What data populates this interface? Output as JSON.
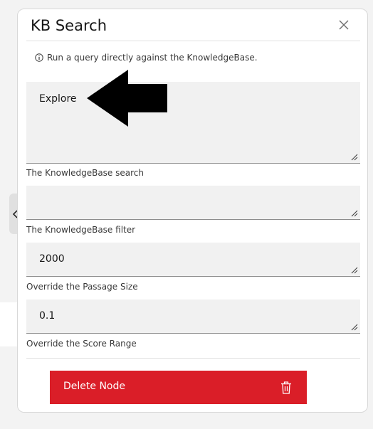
{
  "panel": {
    "title": "KB Search",
    "info_text": "Run a query directly against the KnowledgeBase."
  },
  "fields": [
    {
      "value": "Explore",
      "label": "The KnowledgeBase search"
    },
    {
      "value": "",
      "label": "The KnowledgeBase filter"
    },
    {
      "value": "2000",
      "label": "Override the Passage Size"
    },
    {
      "value": "0.1",
      "label": "Override the Score Range"
    }
  ],
  "delete_button": {
    "label": "Delete Node"
  },
  "icons": {
    "close": "close-icon",
    "info": "info-icon",
    "collapse": "chevron-left-icon",
    "trash": "trash-icon",
    "annotation": "left-arrow-annotation"
  },
  "colors": {
    "danger": "#da1e28",
    "field_bg": "#f1f1f1"
  }
}
